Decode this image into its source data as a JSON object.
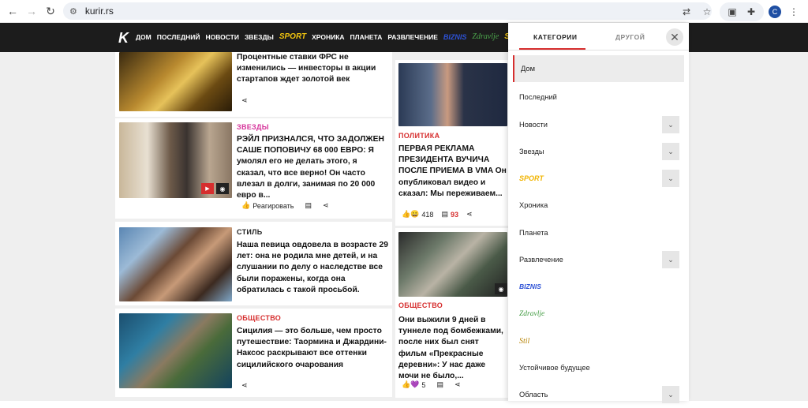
{
  "browser": {
    "url": "kurir.rs"
  },
  "site_nav": {
    "logo": "K",
    "items": [
      "ДОМ",
      "ПОСЛЕДНИЙ",
      "НОВОСТИ",
      "ЗВЕЗДЫ",
      "SPORT",
      "ХРОНИКА",
      "ПЛАНЕТА",
      "РАЗВЛЕЧЕНИЕ",
      "BIZNIS",
      "Zdravlje",
      "S"
    ]
  },
  "articles": {
    "a1": {
      "headline": "Процентные ставки ФРС не изменились — инвесторы в акции стартапов ждет золотой век"
    },
    "a2": {
      "category": "ЗВЕЗДЫ",
      "headline": "РЭЙЛ ПРИЗНАЛСЯ, ЧТО ЗАДОЛЖЕН САШЕ ПОПОВИЧУ 68 000 ЕВРО: Я умолял его не делать этого, я сказал, что все верно! Он часто влезал в долги, занимая по 20 000 евро в...",
      "react_label": "Реагировать"
    },
    "a3": {
      "category": "СТИЛЬ",
      "headline": "Наша певица овдовела в возрасте 29 лет: она не родила мне детей, и на слушании по делу о наследстве все были поражены, когда она обратилась с такой просьбой."
    },
    "a4": {
      "category": "ОБЩЕСТВО",
      "headline": "Сицилия — это больше, чем просто путешествие: Таормина и Джардини-Наксос раскрывают все оттенки сицилийского очарования"
    },
    "b1": {
      "category": "ПОЛИТИКА",
      "headline": "ПЕРВАЯ РЕКЛАМА ПРЕЗИДЕНТА ВУЧИЧА ПОСЛЕ ПРИЕМА В VMA Он опубликовал видео и сказал: Мы переживаем...",
      "reactions": "418",
      "comments": "93"
    },
    "b2": {
      "category": "ОБЩЕСТВО",
      "headline": "Они выжили 9 дней в туннеле под бомбежками, после них был снят фильм «Прекрасные деревни»: У нас даже мочи не было,...",
      "reactions": "5"
    }
  },
  "panel": {
    "tab_active": "КАТЕГОРИИ",
    "tab_inactive": "ДРУГОЙ",
    "items": [
      {
        "label": "Дом"
      },
      {
        "label": "Последний"
      },
      {
        "label": "Новости"
      },
      {
        "label": "Звезды"
      },
      {
        "label": "SPORT"
      },
      {
        "label": "Хроника"
      },
      {
        "label": "Планета"
      },
      {
        "label": "Развлечение"
      },
      {
        "label": "BIZNIS"
      },
      {
        "label": "Zdravlje"
      },
      {
        "label": "Stil"
      },
      {
        "label": "Устойчивое будущее"
      },
      {
        "label": "Область"
      }
    ]
  },
  "colors": {
    "accent": "#d62e2e",
    "nav_bg": "#1c1c1c",
    "category_zvezdy": "#d6339a",
    "category_red": "#d62e2e"
  }
}
